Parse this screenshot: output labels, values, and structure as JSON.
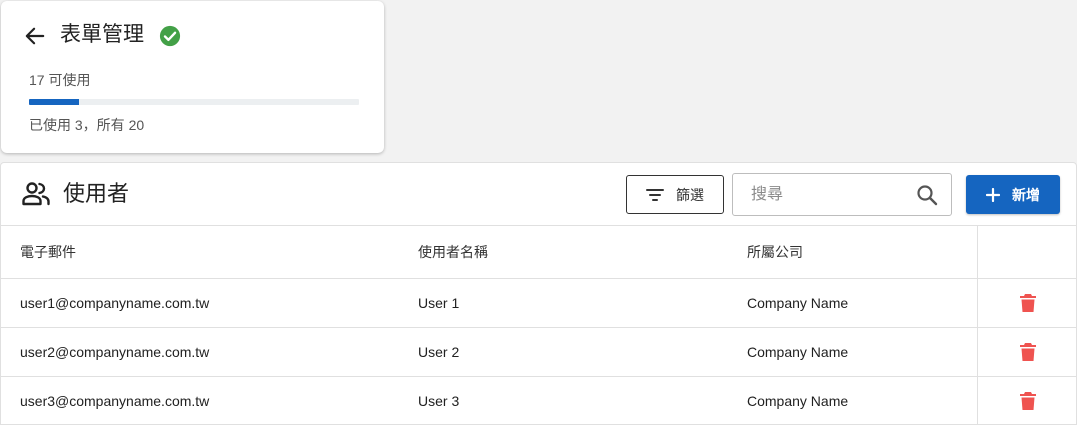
{
  "summary": {
    "title": "表單管理",
    "available_text": "17 可使用",
    "progress_fraction": 0.15,
    "usage_text": "已使用 3，所有 20",
    "icons": {
      "back": "arrow-left-icon",
      "status": "check-circle-icon"
    }
  },
  "users_panel": {
    "title": "使用者",
    "filter_label": "篩選",
    "search_placeholder": "搜尋",
    "add_label": "新增",
    "icons": {
      "section": "users-icon",
      "filter": "filter-icon",
      "search": "search-icon",
      "add": "plus-icon",
      "delete": "trash-icon"
    }
  },
  "table": {
    "headers": [
      "電子郵件",
      "使用者名稱",
      "所屬公司"
    ],
    "rows": [
      {
        "email": "user1@companyname.com.tw",
        "name": "User 1",
        "company": "Company Name"
      },
      {
        "email": "user2@companyname.com.tw",
        "name": "User 2",
        "company": "Company Name"
      },
      {
        "email": "user3@companyname.com.tw",
        "name": "User 3",
        "company": "Company Name"
      }
    ]
  },
  "colors": {
    "primary": "#1565c0",
    "success": "#43a047",
    "danger": "#ef5350",
    "background": "#f2f2f2"
  }
}
